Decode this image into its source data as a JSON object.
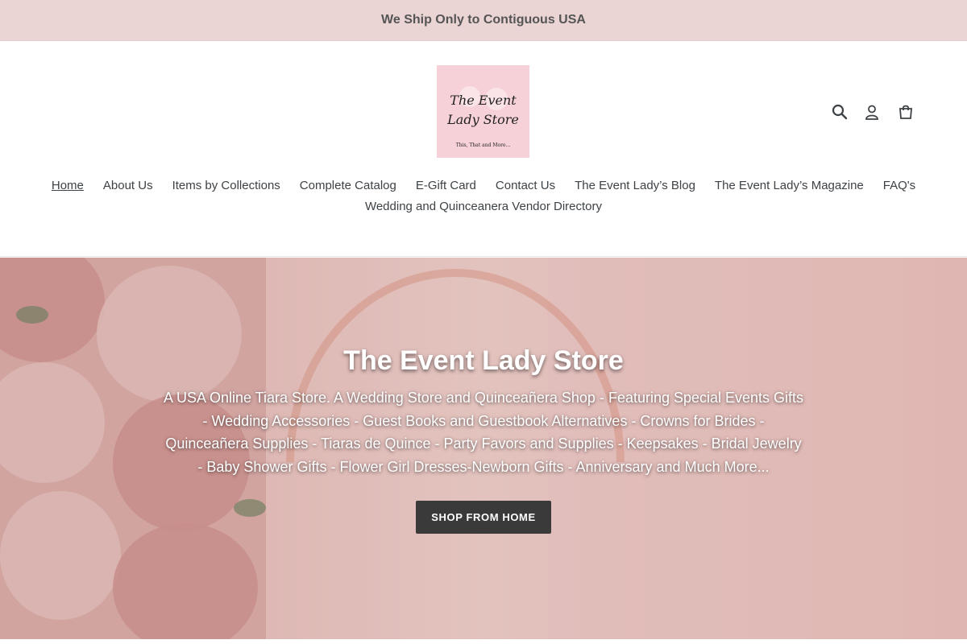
{
  "announcement": {
    "text": "We Ship Only to Contiguous USA"
  },
  "logo": {
    "line1": "The Event",
    "line2": "Lady Store",
    "tagline": "This, That and More..."
  },
  "header_icons": {
    "search": "search-icon",
    "account": "user-icon",
    "cart": "cart-icon"
  },
  "nav": {
    "row1": [
      {
        "label": "Home",
        "active": true
      },
      {
        "label": "About Us"
      },
      {
        "label": "Items by Collections"
      },
      {
        "label": "Complete Catalog"
      },
      {
        "label": "E-Gift Card"
      },
      {
        "label": "Contact Us"
      },
      {
        "label": "The Event Lady’s Blog"
      },
      {
        "label": "The Event Lady’s Magazine"
      },
      {
        "label": "FAQ's"
      }
    ],
    "row2": [
      {
        "label": "Wedding and Quinceanera Vendor Directory"
      }
    ]
  },
  "hero": {
    "title": "The Event Lady Store",
    "subtitle": "A USA Online Tiara Store. A Wedding Store and Quinceañera Shop - Featuring Special Events Gifts - Wedding Accessories - Guest Books and Guestbook Alternatives - Crowns for Brides - Quinceañera Supplies - Tiaras de Quince - Party Favors and Supplies - Keepsakes - Bridal Jewelry - Baby Shower Gifts - Flower Girl Dresses-Newborn Gifts - Anniversary and Much More...",
    "button_label": "SHOP FROM HOME"
  },
  "colors": {
    "announcement_bg": "#ead4d4",
    "logo_bg": "#f6d2d8",
    "button_bg": "#3a3a3a",
    "text": "#3d4246"
  }
}
